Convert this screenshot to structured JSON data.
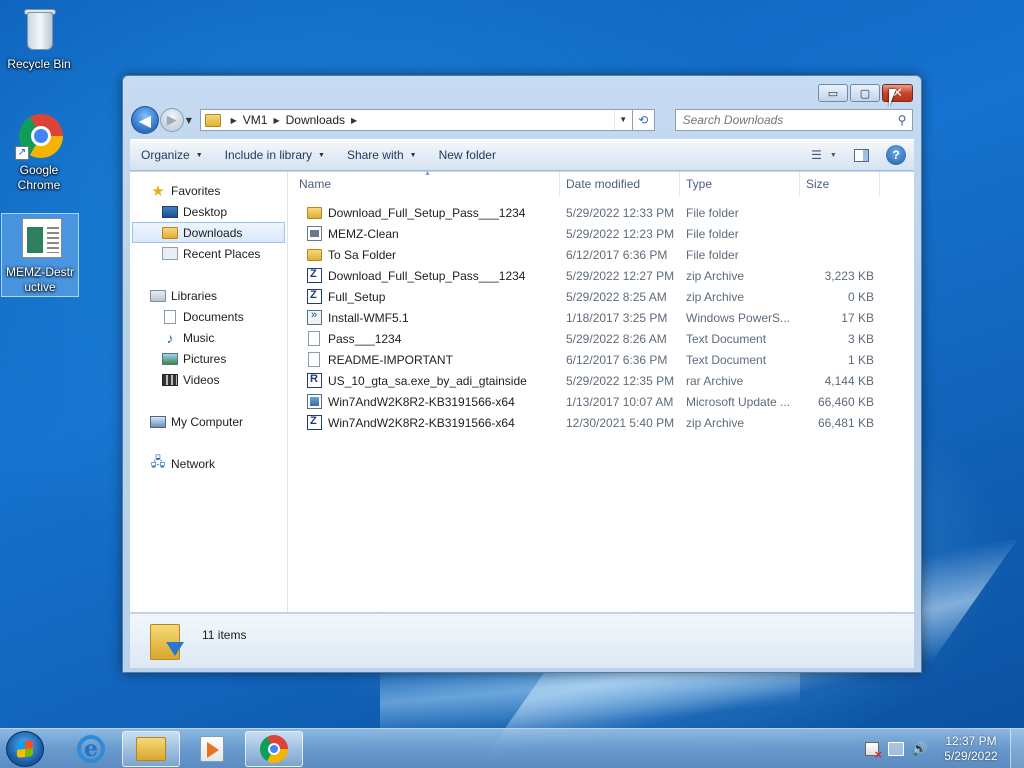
{
  "desktop": {
    "icons": [
      {
        "label": "Recycle Bin"
      },
      {
        "label": "Google Chrome"
      },
      {
        "label": "MEMZ-Destructive"
      }
    ]
  },
  "window": {
    "caption_buttons": {
      "minimize": "▭",
      "maximize": "▢",
      "close": "✕"
    },
    "nav": {
      "back_glyph": "◀",
      "forward_glyph": "▶",
      "breadcrumb": [
        "VM1",
        "Downloads"
      ],
      "search_placeholder": "Search Downloads"
    },
    "toolbar": {
      "organize": "Organize",
      "include_in_library": "Include in library",
      "share_with": "Share with",
      "new_folder": "New folder",
      "help": "?"
    },
    "nav_pane": {
      "favorites": {
        "label": "Favorites",
        "items": [
          "Desktop",
          "Downloads",
          "Recent Places"
        ]
      },
      "libraries": {
        "label": "Libraries",
        "items": [
          "Documents",
          "Music",
          "Pictures",
          "Videos"
        ]
      },
      "computer": "My Computer",
      "network": "Network"
    },
    "columns": {
      "name": "Name",
      "date": "Date modified",
      "type": "Type",
      "size": "Size"
    },
    "files": [
      {
        "name": "Download_Full_Setup_Pass___1234",
        "date": "5/29/2022 12:33 PM",
        "type": "File folder",
        "size": "",
        "icon": "folder-icon"
      },
      {
        "name": "MEMZ-Clean",
        "date": "5/29/2022 12:23 PM",
        "type": "File folder",
        "size": "",
        "icon": "application-icon"
      },
      {
        "name": "To Sa Folder",
        "date": "6/12/2017 6:36 PM",
        "type": "File folder",
        "size": "",
        "icon": "folder-icon"
      },
      {
        "name": "Download_Full_Setup_Pass___1234",
        "date": "5/29/2022 12:27 PM",
        "type": "zip Archive",
        "size": "3,223 KB",
        "icon": "zip-archive-icon"
      },
      {
        "name": "Full_Setup",
        "date": "5/29/2022 8:25 AM",
        "type": "zip Archive",
        "size": "0 KB",
        "icon": "zip-archive-icon"
      },
      {
        "name": "Install-WMF5.1",
        "date": "1/18/2017 3:25 PM",
        "type": "Windows PowerS...",
        "size": "17 KB",
        "icon": "powershell-script-icon"
      },
      {
        "name": "Pass___1234",
        "date": "5/29/2022 8:26 AM",
        "type": "Text Document",
        "size": "3 KB",
        "icon": "text-document-icon"
      },
      {
        "name": "README-IMPORTANT",
        "date": "6/12/2017 6:36 PM",
        "type": "Text Document",
        "size": "1 KB",
        "icon": "text-document-icon"
      },
      {
        "name": "US_10_gta_sa.exe_by_adi_gtainside",
        "date": "5/29/2022 12:35 PM",
        "type": "rar Archive",
        "size": "4,144 KB",
        "icon": "rar-archive-icon"
      },
      {
        "name": "Win7AndW2K8R2-KB3191566-x64",
        "date": "1/13/2017 10:07 AM",
        "type": "Microsoft Update ...",
        "size": "66,460 KB",
        "icon": "update-package-icon"
      },
      {
        "name": "Win7AndW2K8R2-KB3191566-x64",
        "date": "12/30/2021 5:40 PM",
        "type": "zip Archive",
        "size": "66,481 KB",
        "icon": "zip-archive-icon"
      }
    ],
    "status": {
      "item_count": "11 items"
    }
  },
  "taskbar": {
    "clock_time": "12:37 PM",
    "clock_date": "5/29/2022"
  }
}
